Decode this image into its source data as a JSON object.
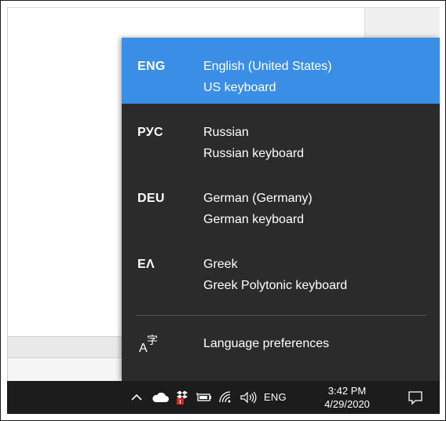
{
  "flyout": {
    "languages": [
      {
        "code": "ENG",
        "name": "English (United States)",
        "keyboard": "US keyboard",
        "selected": true
      },
      {
        "code": "РУС",
        "name": "Russian",
        "keyboard": "Russian keyboard",
        "selected": false
      },
      {
        "code": "DEU",
        "name": "German (Germany)",
        "keyboard": "German keyboard",
        "selected": false
      },
      {
        "code": "ΕΛ",
        "name": "Greek",
        "keyboard": "Greek Polytonic keyboard",
        "selected": false
      }
    ],
    "preferences_label": "Language preferences",
    "preferences_icon_letters": "A字"
  },
  "taskbar": {
    "language_indicator": "ENG",
    "time": "3:42 PM",
    "date": "4/29/2020",
    "icons": [
      "chevron-up-icon",
      "onedrive-cloud-icon",
      "dropbox-icon",
      "battery-icon",
      "wifi-icon",
      "speaker-icon",
      "action-center-icon"
    ]
  },
  "colors": {
    "flyout_bg": "#2b2b2b",
    "selected_bg": "#3a8ee6",
    "taskbar_bg": "#1c1c1c",
    "badge_red": "#e0201c"
  }
}
